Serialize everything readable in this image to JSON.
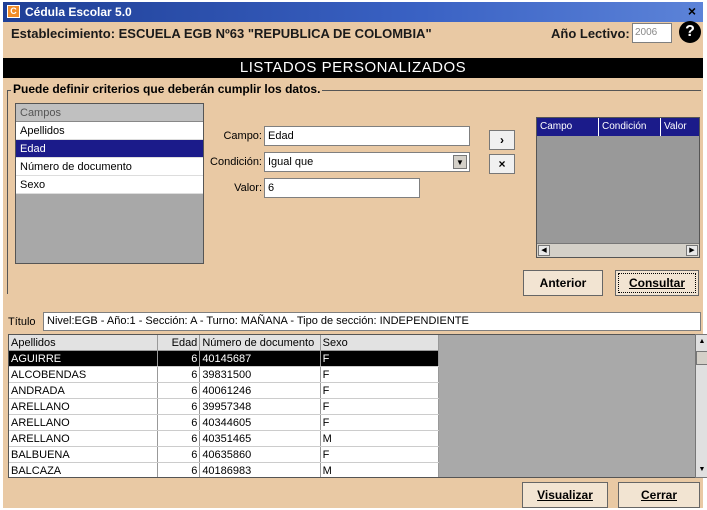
{
  "window": {
    "title": "Cédula Escolar 5.0",
    "close_glyph": "×",
    "app_icon_glyph": "C"
  },
  "header": {
    "establecimiento_label": "Establecimiento: ESCUELA EGB Nº63 \"REPUBLICA DE COLOMBIA\"",
    "anio_label": "Año Lectivo:",
    "anio_value": "2006",
    "help_glyph": "?"
  },
  "section_title": "LISTADOS PERSONALIZADOS",
  "criteria": {
    "legend": "Puede definir criterios que deberán cumplir los datos.",
    "campos_header": "Campos",
    "campos": [
      "Apellidos",
      "Edad",
      "Número de documento",
      "Sexo"
    ],
    "campos_selected": "Edad",
    "campo_label": "Campo:",
    "campo_value": "Edad",
    "condicion_label": "Condición:",
    "condicion_value": "Igual que",
    "valor_label": "Valor:",
    "valor_value": "6",
    "add_button": "›",
    "remove_button": "×",
    "grid_headers": [
      "Campo",
      "Condición",
      "Valor"
    ]
  },
  "buttons": {
    "anterior": "Anterior",
    "consultar": "Consultar",
    "visualizar": "Visualizar",
    "cerrar": "Cerrar"
  },
  "titulo": {
    "label": "Título",
    "value": "Nivel:EGB - Año:1 - Sección: A - Turno: MAÑANA - Tipo de sección: INDEPENDIENTE"
  },
  "results": {
    "headers": [
      "Apellidos",
      "Edad",
      "Número de documento",
      "Sexo"
    ],
    "rows": [
      [
        "AGUIRRE",
        "6",
        "40145687",
        "F"
      ],
      [
        "ALCOBENDAS",
        "6",
        "39831500",
        "F"
      ],
      [
        "ANDRADA",
        "6",
        "40061246",
        "F"
      ],
      [
        "ARELLANO",
        "6",
        "39957348",
        "F"
      ],
      [
        "ARELLANO",
        "6",
        "40344605",
        "F"
      ],
      [
        "ARELLANO",
        "6",
        "40351465",
        "M"
      ],
      [
        "BALBUENA",
        "6",
        "40635860",
        "F"
      ],
      [
        "BALCAZA",
        "6",
        "40186983",
        "M"
      ]
    ],
    "selected_row": 0
  },
  "colors": {
    "titlebar": "#1f3f96",
    "window_bg": "#e9c9a4",
    "selection": "#1b1b8a",
    "section_bar": "#000000"
  }
}
